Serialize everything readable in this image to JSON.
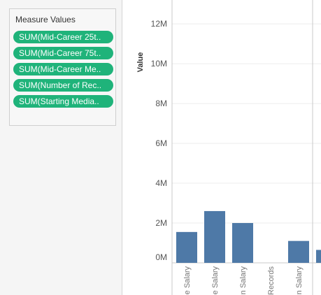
{
  "measure_values": {
    "title": "Measure Values",
    "pills": [
      "SUM(Mid-Career 25t..",
      "SUM(Mid-Career 75t..",
      "SUM(Mid-Career Me..",
      "SUM(Number of Rec..",
      "SUM(Starting Media.."
    ]
  },
  "chart_data": {
    "type": "bar",
    "ylabel": "Value",
    "y_ticks": [
      "0M",
      "2M",
      "4M",
      "6M",
      "8M",
      "10M",
      "12M"
    ],
    "ylim": [
      0,
      13200000
    ],
    "grid": true,
    "categories": [
      "e Salary",
      "e Salary",
      "n Salary",
      "Records",
      "n Salary",
      ""
    ],
    "values": [
      1550000,
      2600000,
      2000000,
      0,
      1100000,
      650000
    ],
    "bar_color": "#4e79a7"
  }
}
